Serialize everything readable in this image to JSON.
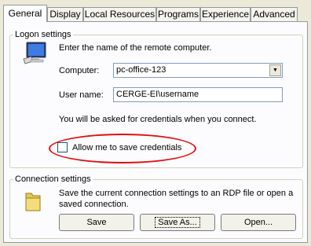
{
  "tabs": [
    {
      "label": "General",
      "active": true
    },
    {
      "label": "Display"
    },
    {
      "label": "Local Resources"
    },
    {
      "label": "Programs"
    },
    {
      "label": "Experience"
    },
    {
      "label": "Advanced"
    }
  ],
  "logon": {
    "legend": "Logon settings",
    "description": "Enter the name of the remote computer.",
    "computer_label": "Computer:",
    "computer_value": "pc-office-123",
    "username_label": "User name:",
    "username_value": "CERGE-EI\\username",
    "credentials_note": "You will be asked for credentials when you connect.",
    "save_credentials_label": "Allow me to save credentials",
    "save_credentials_checked": false
  },
  "connection": {
    "legend": "Connection settings",
    "description_line1": "Save the current connection settings to an RDP file or open a",
    "description_line2": "saved connection.",
    "save_label": "Save",
    "save_as_label": "Save As...",
    "open_label": "Open..."
  },
  "annotation": {
    "color": "#e01010"
  }
}
